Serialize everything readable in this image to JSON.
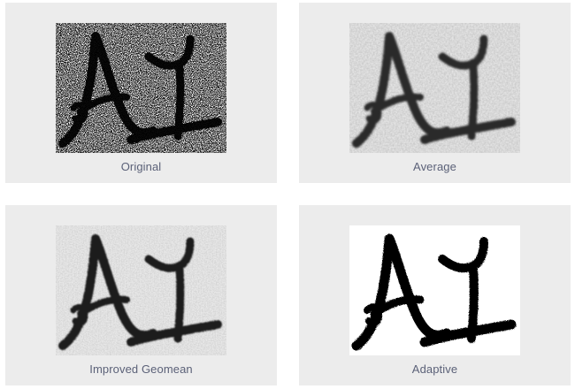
{
  "gallery": {
    "items": [
      {
        "caption": "Original",
        "variant": "salt-and-pepper-noise",
        "background": "#f4f4f4",
        "ink": "#111111"
      },
      {
        "caption": "Average",
        "variant": "blurred-gray-noise",
        "background": "#e4e4e4",
        "ink": "#2a2a2a"
      },
      {
        "caption": "Improved Geomean",
        "variant": "mild-gray-noise",
        "background": "#e8e8e8",
        "ink": "#1f1f1f"
      },
      {
        "caption": "Adaptive",
        "variant": "clean-binary",
        "background": "#ffffff",
        "ink": "#050505"
      }
    ]
  },
  "colors": {
    "card_background": "#ececec",
    "caption_text": "#5b6178"
  }
}
